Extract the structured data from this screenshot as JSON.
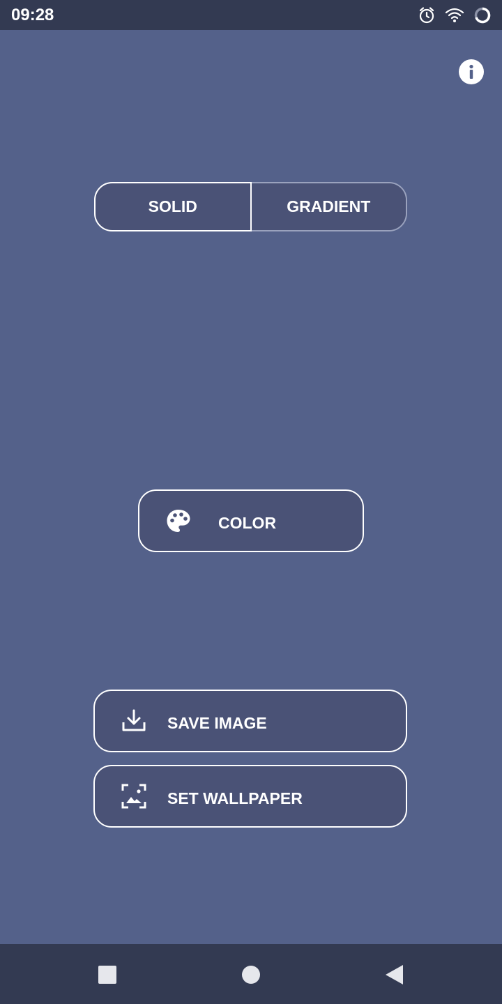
{
  "status_bar": {
    "time": "09:28",
    "icons": [
      "alarm-icon",
      "wifi-icon",
      "loading-icon"
    ]
  },
  "header": {
    "info_icon": "info-icon"
  },
  "mode_toggle": {
    "options": [
      "SOLID",
      "GRADIENT"
    ],
    "selected": "SOLID"
  },
  "color_button": {
    "label": "COLOR",
    "icon": "palette-icon"
  },
  "actions": {
    "save_label": "SAVE IMAGE",
    "save_icon": "download-icon",
    "wallpaper_label": "SET WALLPAPER",
    "wallpaper_icon": "wallpaper-icon"
  },
  "nav_bar": {
    "icons": [
      "recents-square-icon",
      "home-circle-icon",
      "back-triangle-icon"
    ]
  },
  "colors": {
    "background": "#54618a",
    "bars": "#333a52",
    "button_fill": "#4a5276",
    "accent": "#ffffff"
  }
}
